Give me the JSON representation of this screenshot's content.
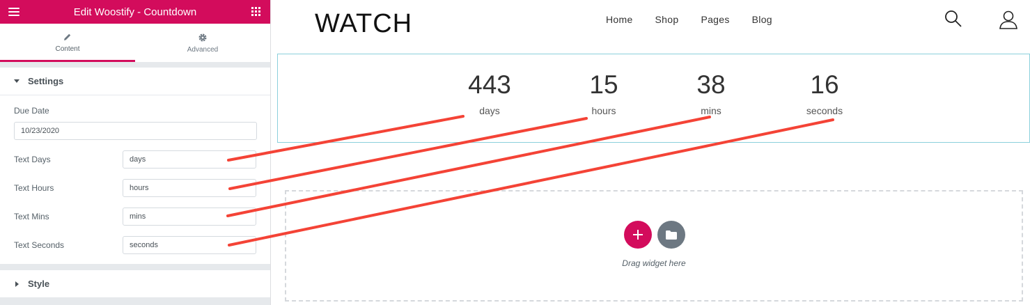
{
  "editor": {
    "title": "Edit Woostify - Countdown",
    "tabs": [
      {
        "label": "Content",
        "icon": "pencil-icon"
      },
      {
        "label": "Advanced",
        "icon": "gear-icon"
      }
    ],
    "settings": {
      "title": "Settings",
      "due_date_label": "Due Date",
      "due_date_value": "10/23/2020",
      "fields": [
        {
          "label": "Text Days",
          "value": "days"
        },
        {
          "label": "Text Hours",
          "value": "hours"
        },
        {
          "label": "Text Mins",
          "value": "mins"
        },
        {
          "label": "Text Seconds",
          "value": "seconds"
        }
      ]
    },
    "style_section": {
      "title": "Style"
    }
  },
  "site": {
    "logo_text": "WATCH",
    "nav": [
      "Home",
      "Shop",
      "Pages",
      "Blog"
    ],
    "icons": [
      "search-icon",
      "user-icon"
    ],
    "countdown": [
      {
        "value": "443",
        "label": "days"
      },
      {
        "value": "15",
        "label": "hours"
      },
      {
        "value": "38",
        "label": "mins"
      },
      {
        "value": "16",
        "label": "seconds"
      }
    ],
    "drop_zone": {
      "text": "Drag widget here"
    }
  },
  "colors": {
    "brand": "#d30c5c",
    "annotation": "#f44336",
    "countdown_border": "#8bd0dc",
    "folder_button": "#6d7882"
  }
}
